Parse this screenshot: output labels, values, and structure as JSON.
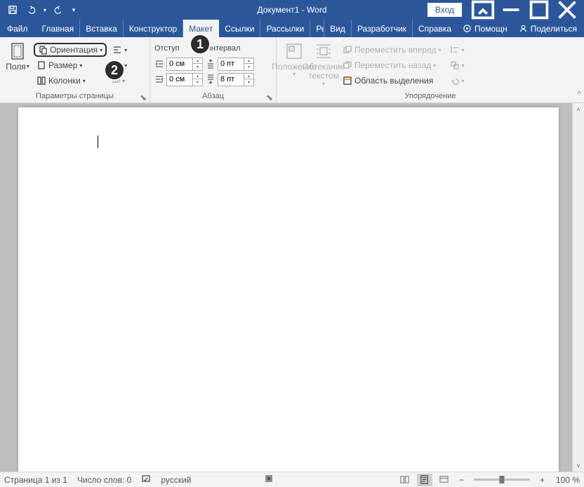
{
  "title": "Документ1 - Word",
  "login": "Вход",
  "tabs": [
    "Файл",
    "Главная",
    "Вставка",
    "Конструктор",
    "Макет",
    "Ссылки",
    "Рассылки",
    "Рецензирование",
    "Вид",
    "Разработчик",
    "Справка"
  ],
  "active_tab_index": 4,
  "help": {
    "tell_me": "Помощн",
    "share": "Поделиться"
  },
  "page_setup": {
    "label": "Параметры страницы",
    "margins": "Поля",
    "orientation": "Ориентация",
    "size": "Размер",
    "columns": "Колонки",
    "breaks_tip": "be"
  },
  "paragraph": {
    "label": "Абзац",
    "indent_head": "Отступ",
    "spacing_head": "Интервал",
    "indent_left": "0 см",
    "indent_right": "0 см",
    "spacing_before": "0 пт",
    "spacing_after": "8 пт"
  },
  "arrange": {
    "label": "Упорядочение",
    "position": "Положение",
    "wrap": "Обтекание текстом",
    "bring_forward": "Переместить вперед",
    "send_backward": "Переместить назад",
    "selection_pane": "Область выделения"
  },
  "status": {
    "page": "Страница 1 из 1",
    "words": "Число слов: 0",
    "language": "русский",
    "zoom": "100 %"
  },
  "callouts": {
    "one": "1",
    "two": "2"
  }
}
